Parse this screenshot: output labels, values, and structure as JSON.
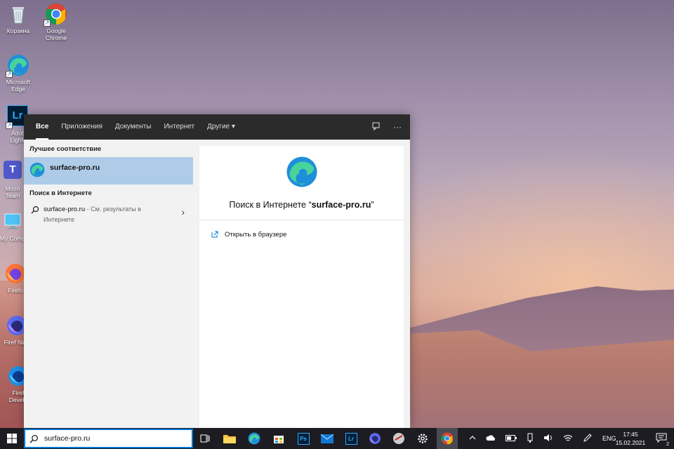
{
  "desktop": {
    "icons": [
      {
        "label": "Корзина",
        "icon": "recycle-bin-icon"
      },
      {
        "label": "Google Chrome",
        "icon": "chrome-icon"
      },
      {
        "label": "Microsoft Edge",
        "icon": "edge-icon"
      },
      {
        "label": "Adob Lighte",
        "icon": "lightroom-icon"
      },
      {
        "label": "Micro Team",
        "icon": "teams-icon"
      },
      {
        "label": "My Comp",
        "icon": "computer-icon"
      },
      {
        "label": "Firefo",
        "icon": "firefox-icon"
      },
      {
        "label": "Firef Nigh",
        "icon": "firefox-nightly-icon"
      },
      {
        "label": "Firef Develo",
        "icon": "firefox-dev-icon"
      }
    ]
  },
  "search_panel": {
    "tabs": [
      {
        "label": "Все",
        "active": true
      },
      {
        "label": "Приложения"
      },
      {
        "label": "Документы"
      },
      {
        "label": "Интернет"
      },
      {
        "label": "Другие ▾"
      }
    ],
    "best_match_heading": "Лучшее соответствие",
    "best_match_name": "surface-pro.ru",
    "web_heading": "Поиск в Интернете",
    "web_result_query": "surface-pro.ru",
    "web_result_hint": " - См. результаты в Интернете",
    "preview_title_prefix": "Поиск в Интернете “",
    "preview_title_query": "surface-pro.ru",
    "preview_title_suffix": "”",
    "open_in_browser": "Открыть в браузере"
  },
  "taskbar": {
    "search_value": "surface-pro.ru",
    "language": "ENG",
    "time": "17:45",
    "date": "15.02.2021",
    "notification_count": "2"
  },
  "colors": {
    "accent": "#0078d7",
    "best_match_bg": "#aecbe7",
    "tabs_bg": "#2b2b2b",
    "taskbar_bg": "#1c1c22"
  }
}
